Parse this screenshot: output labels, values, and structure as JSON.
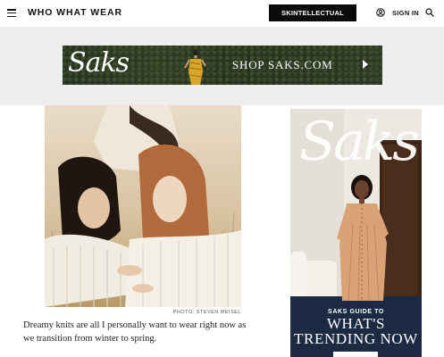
{
  "header": {
    "logo": "WHO WHAT WEAR",
    "cta_label": "SKINTELLECTUAL",
    "signin_label": "SIGN IN"
  },
  "top_ad": {
    "brand": "Saks",
    "cta": "SHOP SAKS.COM"
  },
  "article": {
    "photo_credit": "PHOTO: STEVEN MEISEL",
    "body": "Dreamy knits are all I personally want to wear right now as we transition from winter to spring."
  },
  "side_ad": {
    "brand": "Saks",
    "kicker": "SAKS GUIDE TO",
    "headline_line1": "WHAT'S",
    "headline_line2": "TRENDING NOW"
  },
  "icons": [
    "hamburger-menu-icon",
    "user-icon",
    "search-icon",
    "chevron-right-icon"
  ],
  "colors": {
    "header_bg": "#ffffff",
    "cta_bg": "#0b0b0b",
    "ad_band_bg": "#eeeeee",
    "top_ad_bg": "#2a3621",
    "side_ad_bg": "#ece8e2"
  }
}
